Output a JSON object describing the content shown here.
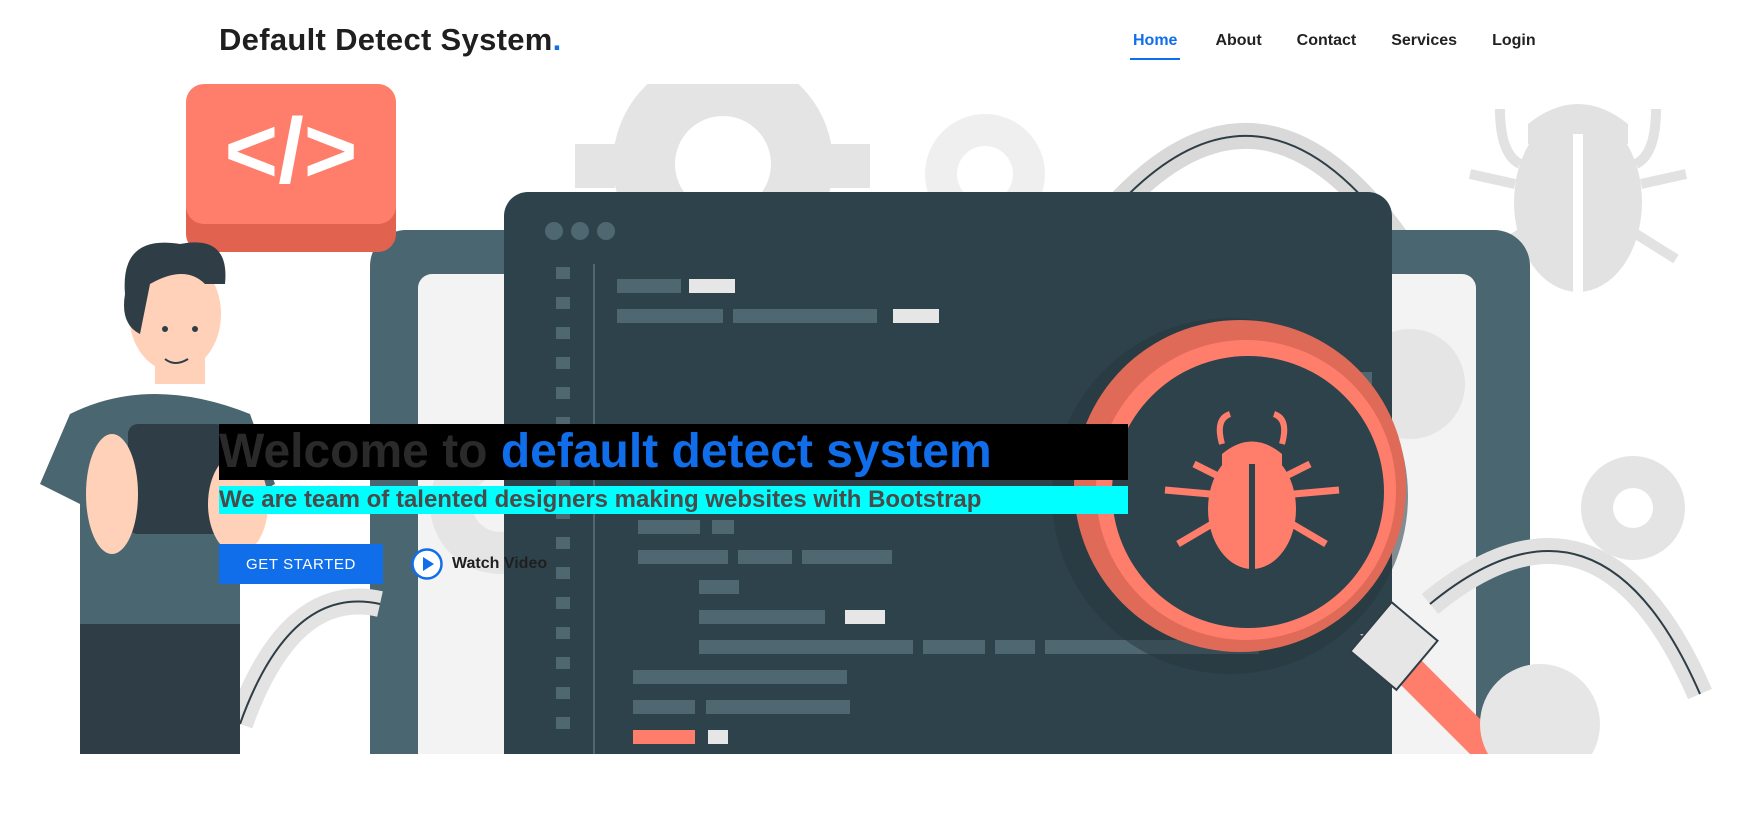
{
  "header": {
    "logo_text": "Default Detect System",
    "logo_dot": ".",
    "nav": [
      {
        "label": "Home",
        "active": true
      },
      {
        "label": "About"
      },
      {
        "label": "Contact"
      },
      {
        "label": "Services"
      },
      {
        "label": "Login"
      }
    ]
  },
  "hero": {
    "title_prefix": "Welcome to ",
    "title_highlight": "default detect system",
    "subtitle": "We are team of talented designers making websites with Bootstrap",
    "cta_label": "GET STARTED",
    "video_label": "Watch Video",
    "code_badge": "</>"
  },
  "colors": {
    "accent": "#106eea",
    "coral": "#ff7e6b",
    "panel_dark": "#2e424b",
    "title_bg": "#000000",
    "subtitle_bg": "#00ffff"
  },
  "icons": [
    "code-badge-icon",
    "bug-icon",
    "magnifier-icon",
    "gear-icon",
    "play-circle-icon"
  ]
}
